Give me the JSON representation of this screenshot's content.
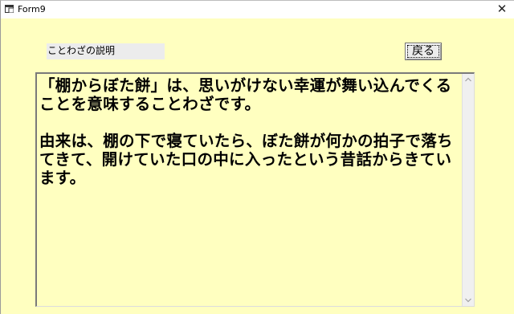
{
  "window": {
    "title": "Form9",
    "close_glyph": "✕",
    "background": "#ffffc0"
  },
  "label": {
    "text": "ことわざの説明"
  },
  "back_button": {
    "label": "戻る"
  },
  "description": {
    "paragraphs": [
      "「棚からぼた餅」は、思いがけない幸運が舞い込んでくることを意味することわざです。",
      "由来は、棚の下で寝ていたら、ぼた餅が何かの拍子で落ちてきて、開けていた口の中に入ったという昔話からきています。"
    ]
  }
}
